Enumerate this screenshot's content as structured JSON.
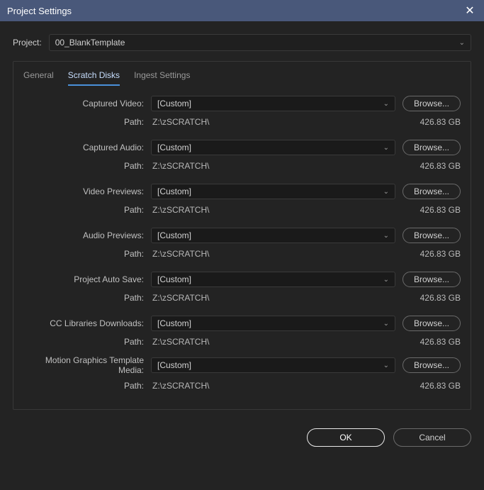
{
  "window": {
    "title": "Project Settings"
  },
  "project": {
    "label": "Project:",
    "value": "00_BlankTemplate"
  },
  "tabs": {
    "general": "General",
    "scratch": "Scratch Disks",
    "ingest": "Ingest Settings"
  },
  "common": {
    "path_label": "Path:",
    "browse": "Browse..."
  },
  "sections": {
    "captured_video": {
      "label": "Captured Video:",
      "value": "[Custom]",
      "path": "Z:\\zSCRATCH\\",
      "storage": "426.83 GB"
    },
    "captured_audio": {
      "label": "Captured Audio:",
      "value": "[Custom]",
      "path": "Z:\\zSCRATCH\\",
      "storage": "426.83 GB"
    },
    "video_previews": {
      "label": "Video Previews:",
      "value": "[Custom]",
      "path": "Z:\\zSCRATCH\\",
      "storage": "426.83 GB"
    },
    "audio_previews": {
      "label": "Audio Previews:",
      "value": "[Custom]",
      "path": "Z:\\zSCRATCH\\",
      "storage": "426.83 GB"
    },
    "auto_save": {
      "label": "Project Auto Save:",
      "value": "[Custom]",
      "path": "Z:\\zSCRATCH\\",
      "storage": "426.83 GB"
    },
    "cc_libraries": {
      "label": "CC Libraries Downloads:",
      "value": "[Custom]",
      "path": "Z:\\zSCRATCH\\",
      "storage": "426.83 GB"
    },
    "mogrt": {
      "label": "Motion Graphics Template Media:",
      "value": "[Custom]",
      "path": "Z:\\zSCRATCH\\",
      "storage": "426.83 GB"
    }
  },
  "footer": {
    "ok": "OK",
    "cancel": "Cancel"
  }
}
